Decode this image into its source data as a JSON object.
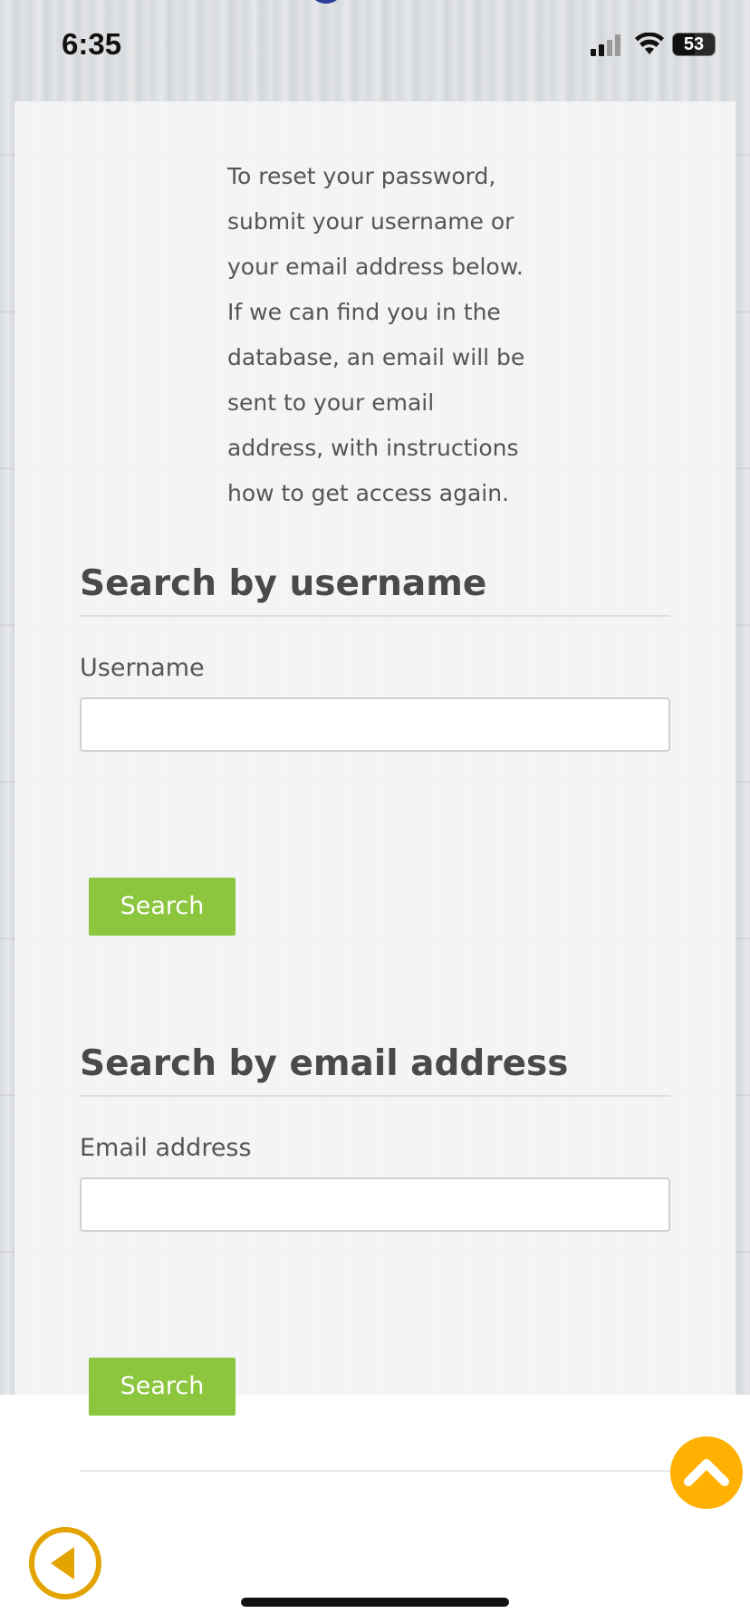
{
  "status_bar": {
    "time": "6:35",
    "battery_text": "53",
    "battery_level_percent": 53
  },
  "intro_text": "To reset your password, submit your username or your email address below. If we can find you in the database, an email will be sent to your email address, with instructions how to get access again.",
  "username_section": {
    "title": "Search by username",
    "field_label": "Username",
    "input_value": "",
    "button_label": "Search"
  },
  "email_section": {
    "title": "Search by email address",
    "field_label": "Email address",
    "input_value": "",
    "button_label": "Search"
  },
  "icons": {
    "scroll_top": "chevron-up-icon",
    "back": "back-arrow-icon"
  },
  "colors": {
    "accent_green": "#8cc63f",
    "scroll_top_orange": "#ffb000",
    "back_orange": "#e3a300"
  }
}
